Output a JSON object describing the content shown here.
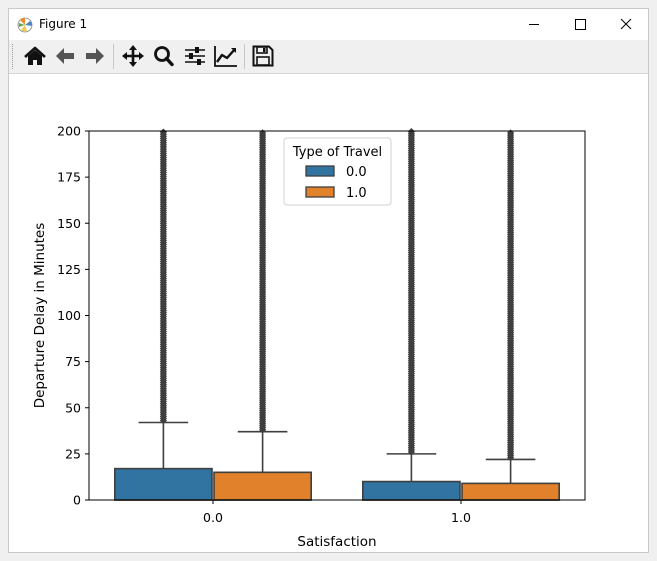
{
  "window": {
    "title": "Figure 1",
    "app_icon": "matplotlib-icon",
    "controls": [
      "minimize-icon",
      "maximize-icon",
      "close-icon"
    ]
  },
  "toolbar": {
    "buttons": [
      {
        "name": "home",
        "icon": "home-icon"
      },
      {
        "name": "back",
        "icon": "arrow-left-icon"
      },
      {
        "name": "forward",
        "icon": "arrow-right-icon"
      },
      {
        "name": "pan",
        "icon": "move-icon"
      },
      {
        "name": "zoom",
        "icon": "magnifier-icon"
      },
      {
        "name": "subplots",
        "icon": "sliders-icon"
      },
      {
        "name": "edit-axis",
        "icon": "line-chart-icon"
      },
      {
        "name": "save",
        "icon": "floppy-disk-icon"
      }
    ]
  },
  "chart_data": {
    "type": "box",
    "title": "",
    "xlabel": "Satisfaction",
    "ylabel": "Departure Delay in Minutes",
    "categories": [
      "0.0",
      "1.0"
    ],
    "ylim": [
      0,
      200
    ],
    "yticks": [
      0,
      25,
      50,
      75,
      100,
      125,
      150,
      175,
      200
    ],
    "grid": false,
    "legend": {
      "title": "Type of Travel",
      "position": "top-center"
    },
    "series": [
      {
        "name": "0.0",
        "color": "#3274a1",
        "boxes": [
          {
            "category": "0.0",
            "min": 0,
            "q1": 0,
            "median": 0,
            "q3": 17,
            "whisker_high": 42,
            "outliers_from": 43,
            "outliers_to": 200
          },
          {
            "category": "1.0",
            "min": 0,
            "q1": 0,
            "median": 0,
            "q3": 10,
            "whisker_high": 25,
            "outliers_from": 26,
            "outliers_to": 200
          }
        ]
      },
      {
        "name": "1.0",
        "color": "#e1812c",
        "boxes": [
          {
            "category": "0.0",
            "min": 0,
            "q1": 0,
            "median": 0,
            "q3": 15,
            "whisker_high": 37,
            "outliers_from": 38,
            "outliers_to": 200
          },
          {
            "category": "1.0",
            "min": 0,
            "q1": 0,
            "median": 0,
            "q3": 9,
            "whisker_high": 22,
            "outliers_from": 23,
            "outliers_to": 200
          }
        ]
      }
    ]
  }
}
